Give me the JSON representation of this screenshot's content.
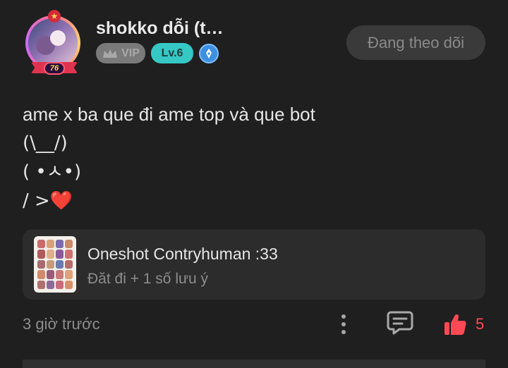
{
  "post": {
    "author": {
      "username": "shokko dỗi (t…",
      "avatar_level": "76",
      "badges": {
        "vip_label": "VIP",
        "level_label": "Lv.6",
        "extra_icon": "pen-nib-icon"
      }
    },
    "follow_button": {
      "label": "Đang theo dõi"
    },
    "content_lines": [
      "ame x ba que đi ame top và que bot",
      "(\\__/)",
      "( •ㅅ•)",
      "/ >❤️"
    ],
    "attachment": {
      "title": "Oneshot Contryhuman :33",
      "subtitle": "Đăt đi + 1 số lưu ý"
    },
    "footer": {
      "timestamp": "3 giờ trước",
      "like_count": "5"
    },
    "colors": {
      "background": "#1f1f1f",
      "card": "#2c2c2c",
      "vip_badge": "#7a7a7a",
      "level_badge": "#36c8c4",
      "like_accent": "#ff4a55"
    }
  }
}
